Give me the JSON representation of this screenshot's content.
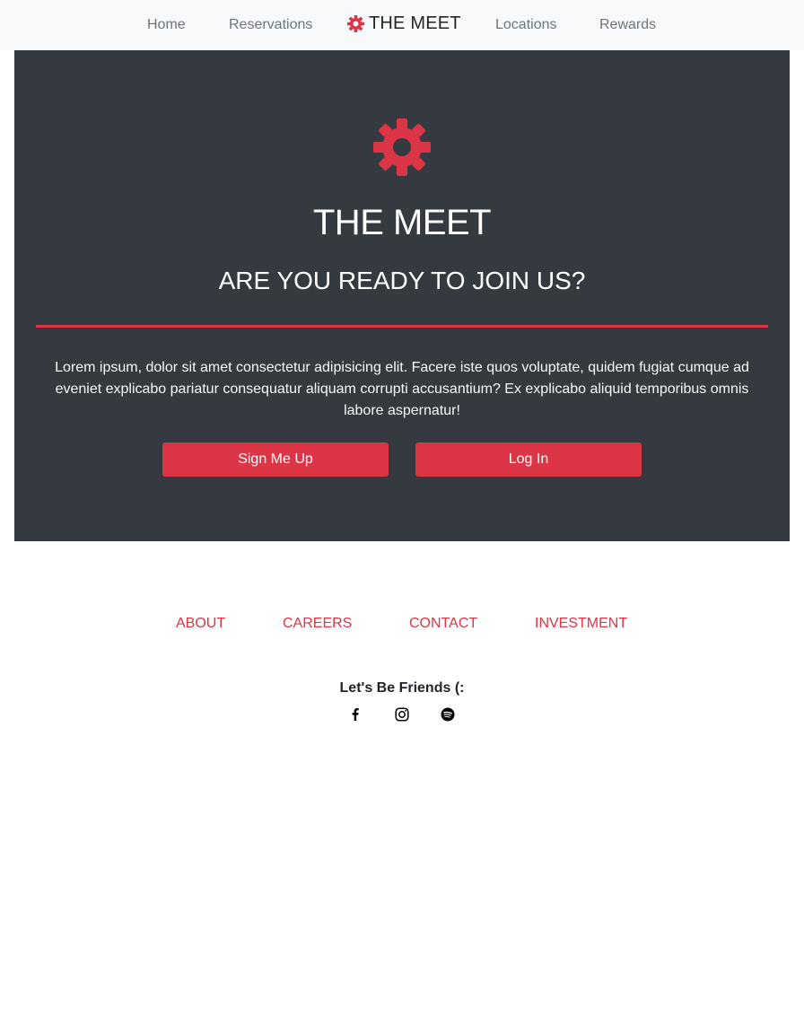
{
  "nav": {
    "home": "Home",
    "reservations": "Reservations",
    "brand": "THE MEET",
    "brand_icon": "gear-icon",
    "locations": "Locations",
    "rewards": "Rewards"
  },
  "hero": {
    "icon": "gear-icon",
    "title": "THE MEET",
    "subtitle": "ARE YOU READY TO JOIN US?",
    "text": "Lorem ipsum, dolor sit amet consectetur adipisicing elit. Facere iste quos voluptate, quidem fugiat cumque ad eveniet explicabo pariatur consequatur aliquam corrupti accusantium? Ex explicabo aliquid temporibus omnis labore aspernatur!",
    "signup_label": "Sign Me Up",
    "login_label": "Log In"
  },
  "footer": {
    "links": [
      "ABOUT",
      "CAREERS",
      "CONTACT",
      "INVESTMENT"
    ],
    "friends": "Let's Be Friends (:",
    "social": [
      "facebook-icon",
      "instagram-icon",
      "spotify-icon"
    ]
  },
  "colors": {
    "accent": "#dc3545",
    "hero_bg": "#343a40",
    "nav_bg": "#f8f9fa",
    "nav_text": "#6c757d"
  }
}
